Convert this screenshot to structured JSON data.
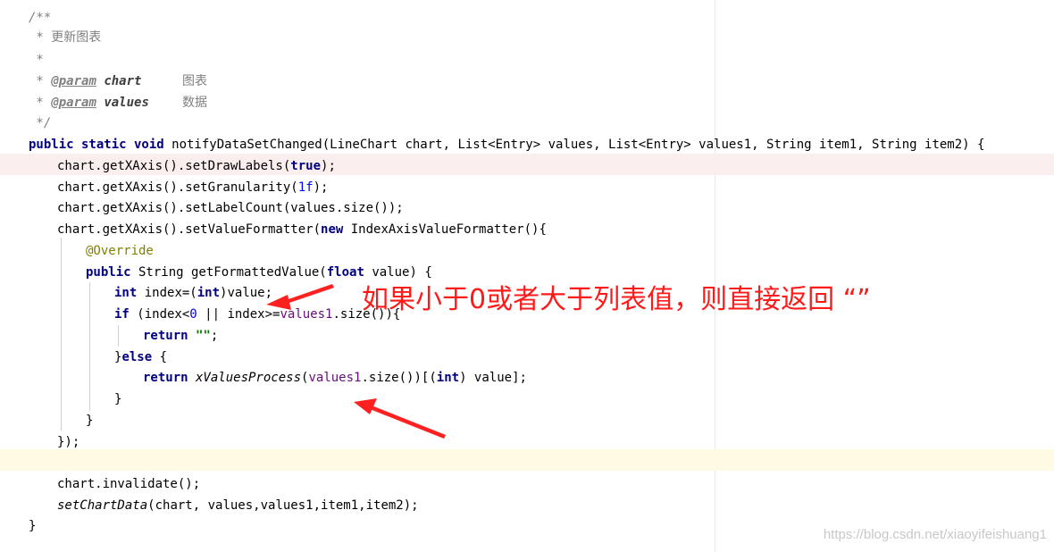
{
  "editor": {
    "lines": {
      "l1": "/**",
      "l2_star": " * ",
      "l2_text": "更新图表",
      "l3": " *",
      "l4_star": " * ",
      "l4_tag": "@param",
      "l4_name": "chart",
      "l4_desc": "图表",
      "l5_star": " * ",
      "l5_tag": "@param",
      "l5_name": "values",
      "l5_desc": "数据",
      "l6": " */",
      "l7_kw": "public static void",
      "l7_rest": " notifyDataSetChanged(LineChart chart, List<Entry> values, List<Entry> values1, String item1, String item2) {",
      "l8_a": "chart.getXAxis().setDrawLabels(",
      "l8_kw": "true",
      "l8_b": ");",
      "l9_a": "chart.getXAxis().setGranularity(",
      "l9_num": "1f",
      "l9_b": ");",
      "l10": "chart.getXAxis().setLabelCount(values.size());",
      "l11_a": "chart.getXAxis().setValueFormatter(",
      "l11_kw": "new",
      "l11_b": " IndexAxisValueFormatter(){",
      "l12": "@Override",
      "l13_kw1": "public",
      "l13_a": " String getFormattedValue(",
      "l13_kw2": "float",
      "l13_b": " value) {",
      "l14_kw1": "int",
      "l14_a": " index=(",
      "l14_kw2": "int",
      "l14_b": ")value;",
      "l15_kw": "if",
      "l15_a": " (index<",
      "l15_num": "0",
      "l15_b": " || index>=",
      "l15_fld": "values1",
      "l15_c": ".size()){",
      "l16_kw": "return",
      "l16_str": " \"\"",
      "l16_b": ";",
      "l17_a": "}",
      "l17_kw": "else",
      "l17_b": " {",
      "l18_kw": "return",
      "l18_it": " xValuesProcess",
      "l18_a": "(",
      "l18_fld": "values1",
      "l18_b": ".size())[(",
      "l18_kw2": "int",
      "l18_c": ") value];",
      "l19": "}",
      "l20": "}",
      "l21": "});",
      "l23": "chart.invalidate();",
      "l24_it": "setChartData",
      "l24_a": "(chart, values,values1,item1,item2);",
      "l25": "}"
    }
  },
  "annotation": {
    "text": "如果小于0或者大于列表值，则直接返回 “”",
    "color": "#ff1a1a"
  },
  "watermark": "https://blog.csdn.net/xiaoyifeishuang1"
}
